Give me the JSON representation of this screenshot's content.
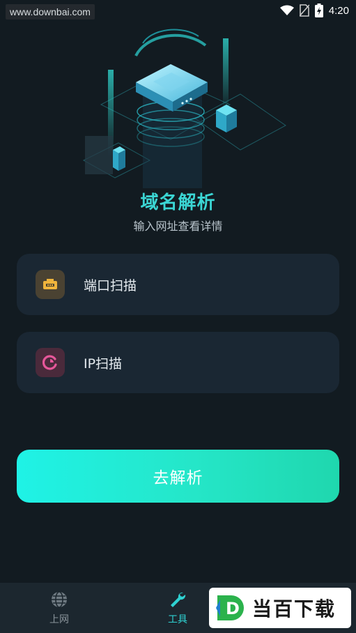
{
  "watermark": "www.downbai.com",
  "status": {
    "time": "4:20"
  },
  "header": {
    "title": "域名解析",
    "subtitle": "输入网址查看详情"
  },
  "menu": [
    {
      "label": "端口扫描",
      "icon": "router-port-icon",
      "color": "#f0b43c"
    },
    {
      "label": "IP扫描",
      "icon": "ip-scan-icon",
      "color": "#e6579a"
    }
  ],
  "action": {
    "label": "去解析"
  },
  "tabs": [
    {
      "label": "上网",
      "icon": "globe-icon",
      "active": false
    },
    {
      "label": "工具",
      "icon": "wrench-icon",
      "active": true
    }
  ],
  "brand": {
    "text": "当百下载",
    "mark": "D"
  },
  "colors": {
    "accent": "#3bd6d4",
    "active_tab": "#2fd2d2",
    "inactive_tab": "#8a949b"
  }
}
